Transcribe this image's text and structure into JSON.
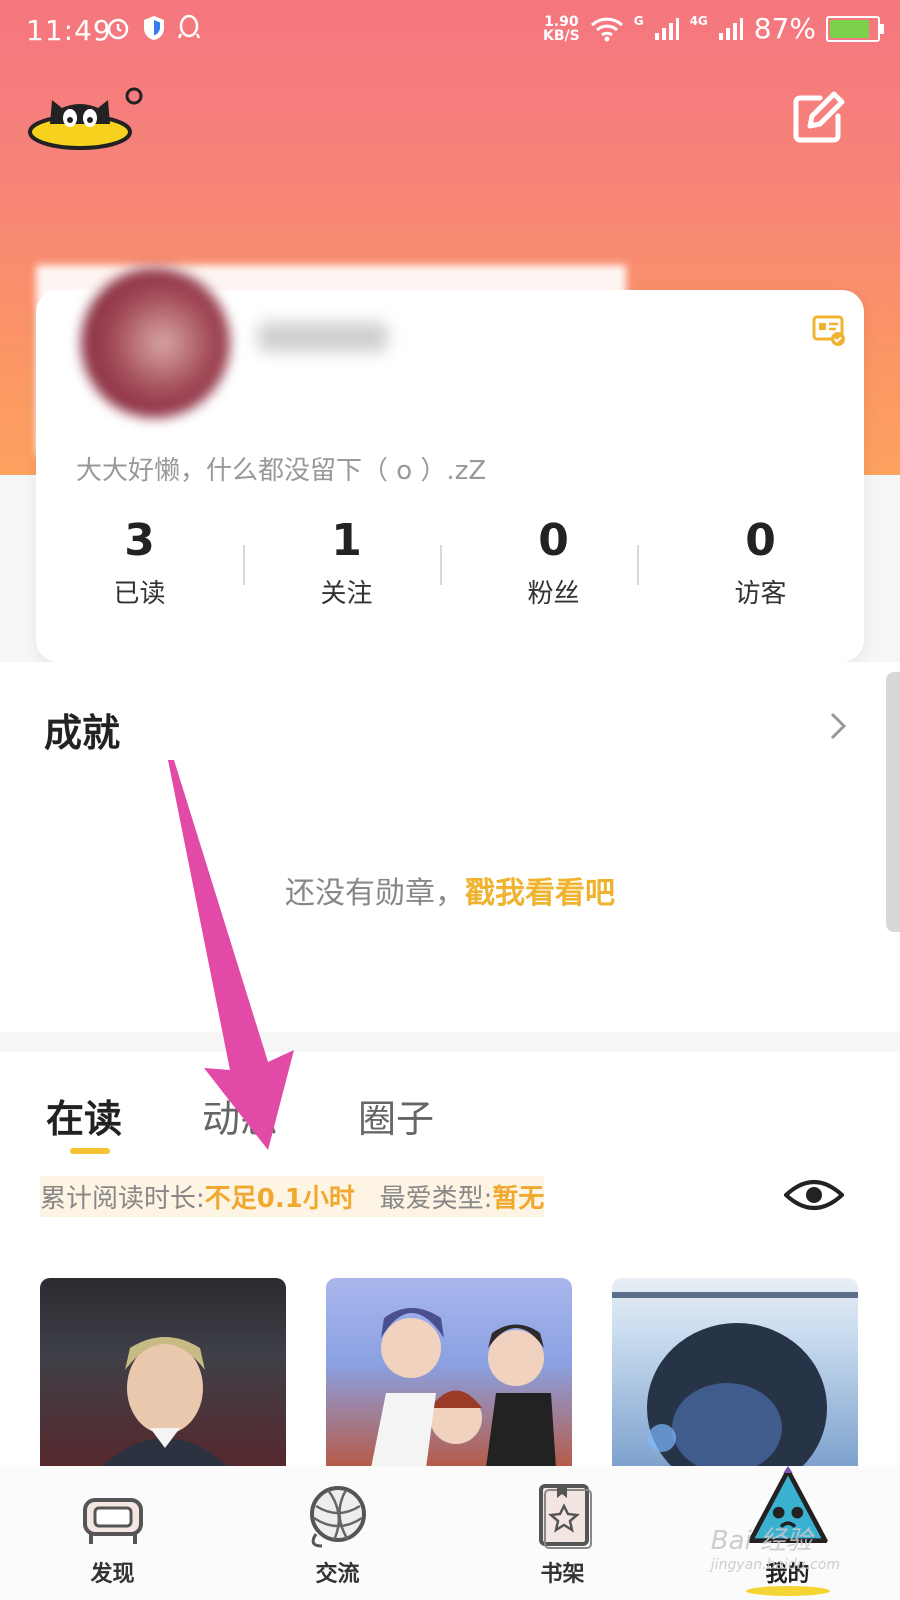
{
  "status_bar": {
    "time": "11:49",
    "speed_value": "1.90",
    "speed_unit": "KB/S",
    "network_g": "G",
    "network_4g": "4G",
    "battery": "87%"
  },
  "profile": {
    "bio": "大大好懒，什么都没留下（  o  ）.zZ"
  },
  "stats": [
    {
      "count": "3",
      "label": "已读"
    },
    {
      "count": "1",
      "label": "关注"
    },
    {
      "count": "0",
      "label": "粉丝"
    },
    {
      "count": "0",
      "label": "访客"
    }
  ],
  "achievements": {
    "title": "成就",
    "empty_text": "还没有勋章，",
    "empty_link": "戳我看看吧"
  },
  "reading": {
    "tabs": [
      "在读",
      "动态",
      "圈子"
    ],
    "duration_label": "累计阅读时长:",
    "duration_value": "不足0.1小时",
    "fav_label": "最爱类型:",
    "fav_value": "暂无"
  },
  "bottom_nav": [
    {
      "label": "发现",
      "icon": "sofa-icon"
    },
    {
      "label": "交流",
      "icon": "yarn-ball-icon"
    },
    {
      "label": "书架",
      "icon": "book-icon"
    },
    {
      "label": "我的",
      "icon": "cat-tent-icon"
    }
  ],
  "watermark": {
    "main": "Bai 经验",
    "sub": "jingyan.baidu.com"
  },
  "colors": {
    "header_top": "#f5767f",
    "header_bottom": "#fca25f",
    "accent": "#f0b330",
    "arrow": "#e24aa8"
  }
}
